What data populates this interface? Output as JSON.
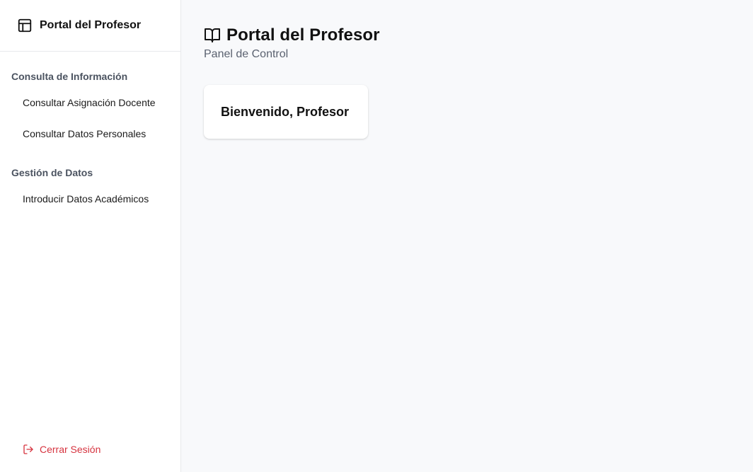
{
  "sidebar": {
    "brand_title": "Portal del Profesor",
    "brand_icon": "layout-icon",
    "sections": [
      {
        "title": "Consulta de Información",
        "items": [
          {
            "label": "Consultar Asignación Docente"
          },
          {
            "label": "Consultar Datos Personales"
          }
        ]
      },
      {
        "title": "Gestión de Datos",
        "items": [
          {
            "label": "Introducir Datos Académicos"
          }
        ]
      }
    ],
    "logout_label": "Cerrar Sesión",
    "logout_icon": "log-out-icon"
  },
  "main": {
    "title": "Portal del Profesor",
    "title_icon": "book-open-icon",
    "subtitle": "Panel de Control",
    "welcome_card": {
      "text": "Bienvenido, Profesor"
    }
  },
  "colors": {
    "logout": "#d6333f",
    "background": "#f8f9fb",
    "sidebar": "#ffffff"
  }
}
